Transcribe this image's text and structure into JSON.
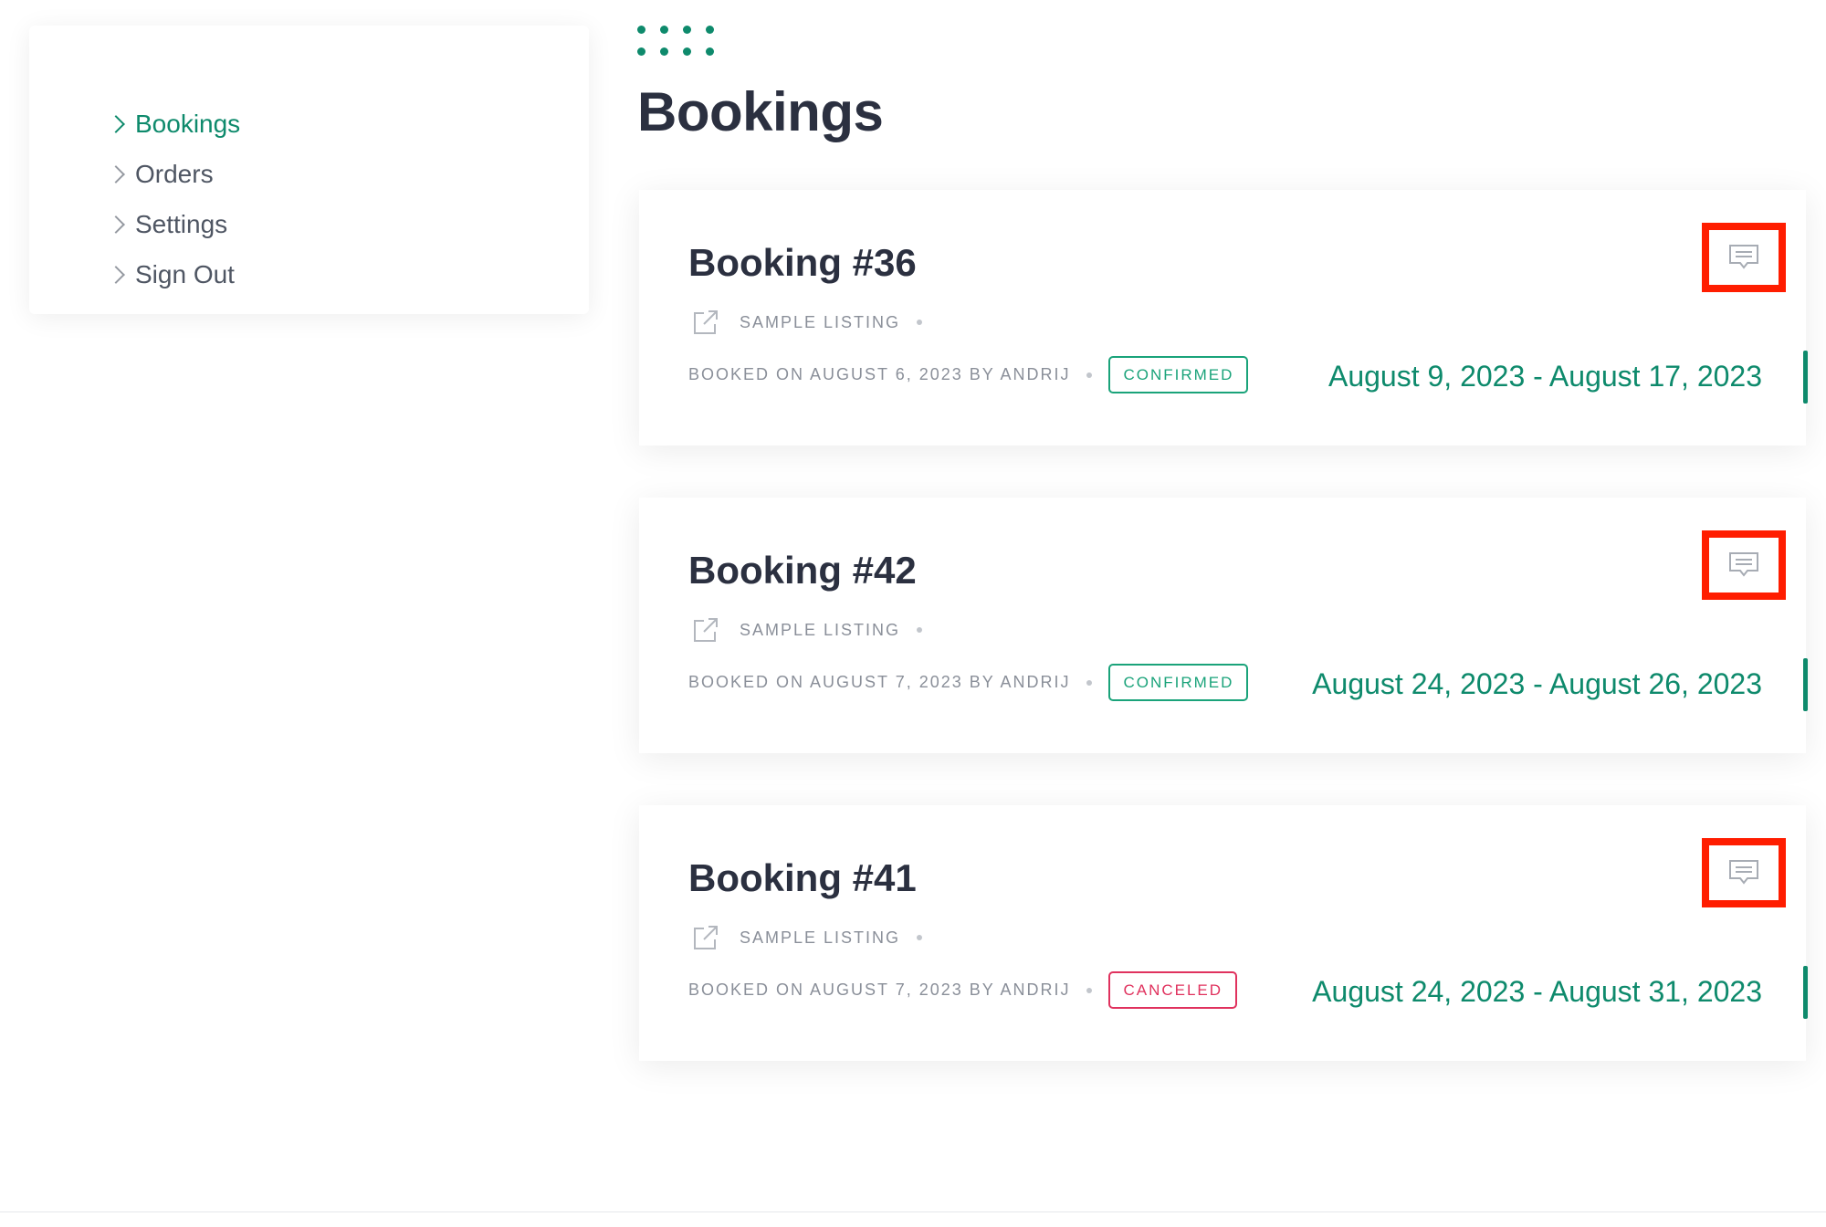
{
  "sidebar": {
    "items": [
      {
        "label": "Bookings",
        "active": true
      },
      {
        "label": "Orders",
        "active": false
      },
      {
        "label": "Settings",
        "active": false
      },
      {
        "label": "Sign Out",
        "active": false
      }
    ]
  },
  "page_title": "Bookings",
  "bookings": [
    {
      "title": "Booking #36",
      "listing": "SAMPLE LISTING",
      "booked_on": "BOOKED ON AUGUST 6, 2023 BY ANDRIJ",
      "status": "CONFIRMED",
      "date_range": "August 9, 2023 - August 17, 2023"
    },
    {
      "title": "Booking #42",
      "listing": "SAMPLE LISTING",
      "booked_on": "BOOKED ON AUGUST 7, 2023 BY ANDRIJ",
      "status": "CONFIRMED",
      "date_range": "August 24, 2023 - August 26, 2023"
    },
    {
      "title": "Booking #41",
      "listing": "SAMPLE LISTING",
      "booked_on": "BOOKED ON AUGUST 7, 2023 BY ANDRIJ",
      "status": "CANCELED",
      "date_range": "August 24, 2023 - August 31, 2023"
    }
  ],
  "icons": {
    "listing_link": "external-link-icon",
    "message": "message-icon",
    "nav": "chevron-right-icon"
  },
  "colors": {
    "accent": "#0e8a6c",
    "confirmed": "#1aa37a",
    "canceled": "#e0325e",
    "highlight": "#ff1d00"
  }
}
